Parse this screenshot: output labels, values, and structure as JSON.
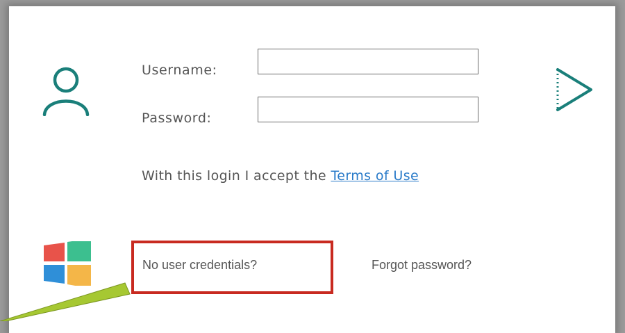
{
  "login": {
    "username_label": "Username:",
    "username_value": "",
    "password_label": "Password:",
    "password_value": "",
    "terms_prefix": "With this login I accept the ",
    "terms_link": "Terms of Use",
    "no_credentials": "No user credentials?",
    "forgot_password": "Forgot password?"
  },
  "icons": {
    "user": "user-icon",
    "submit": "play-icon",
    "windows": "windows-logo-icon"
  },
  "colors": {
    "accent_teal": "#1a7f7a",
    "link_blue": "#2a7bc9",
    "highlight_red": "#c82a20",
    "arrow_green": "#a6c832",
    "win_red": "#e8534a",
    "win_green": "#3cbf8f",
    "win_blue": "#2f8fd8",
    "win_yellow": "#f4b648"
  }
}
